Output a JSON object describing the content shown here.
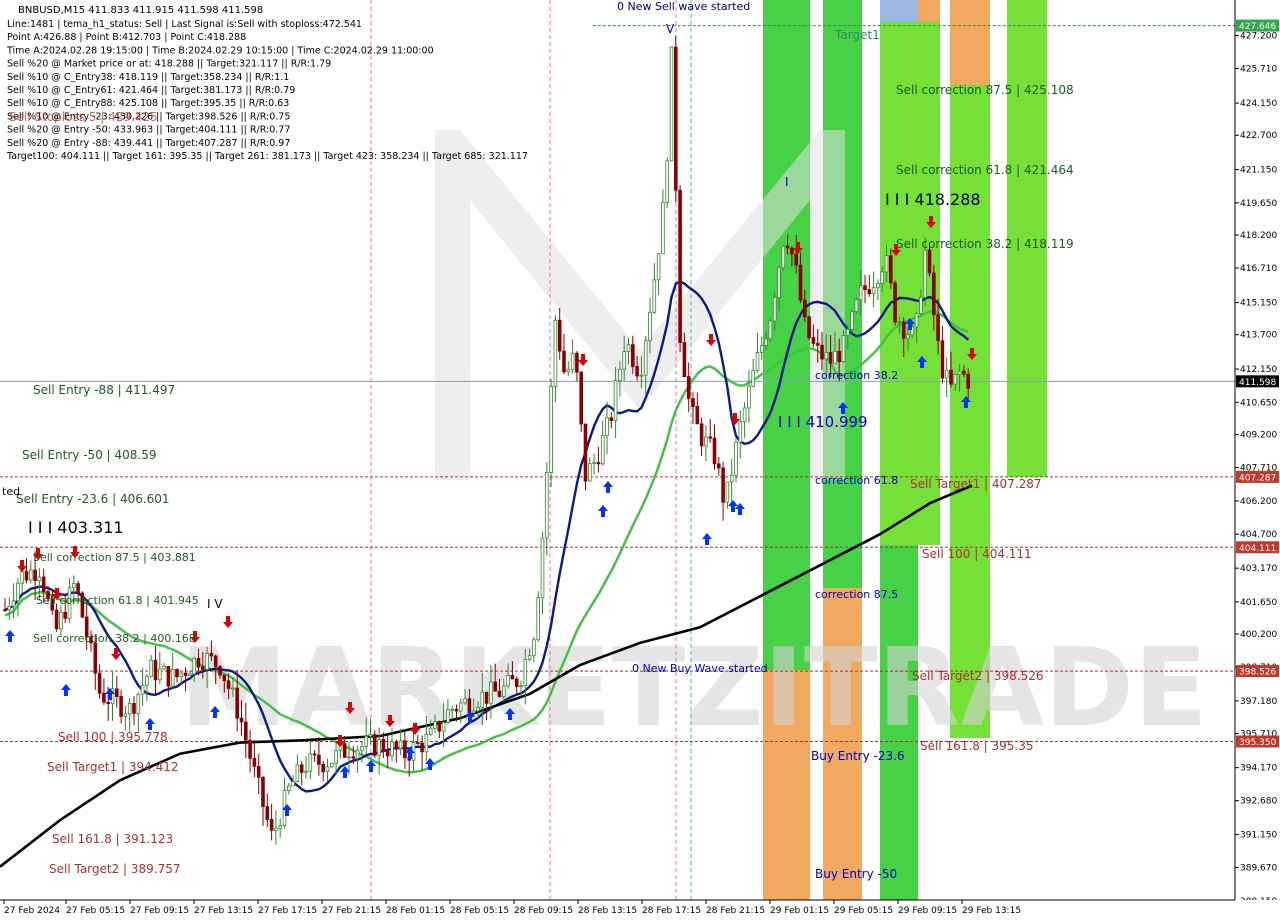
{
  "header": {
    "title": "BNBUSD,M15  411.833 411.915 411.598 411.598",
    "lines": [
      "Line:1481  | tema_h1_status: Sell  | Last Signal is:Sell with stoploss:472.541",
      "Point A:426.88  | Point B:412.703  | Point C:418.288",
      "Time A:2024.02.28 19:15:00  | Time B:2024.02.29 10:15:00  | Time C:2024.02.29 11:00:00",
      "Sell %20 @ Market price or at: 418.288  || Target:321.117  || R/R:1.79",
      "Sell %10 @ C_Entry38: 418.119  || Target:358.234  || R/R:1.1",
      "Sell %10 @ C_Entry61: 421.464  || Target:381.173  || R/R:0.79",
      "Sell %10 @ C_Entry88: 425.108  || Target:395.35  || R/R:0.63",
      "Sell %10 @ Entry -23: 430.226  || Target:398.526  || R/R:0.75",
      "Sell %20 @ Entry -50: 433.963  || Target:404.111  || R/R:0.77",
      "Sell %20 @ Entry -88: 439.441  || Target:407.287  || R/R:0.97",
      "Target100: 404.111  || Target 161: 395.35  || Target 261: 381.173  || Target 423: 358.234  || Target 685: 321.117"
    ],
    "overlay_red": "Sell Stoploss 5 | 429.425"
  },
  "watermark": "MARKETZITRADE",
  "chart_data": {
    "type": "candlestick",
    "symbol": "BNBUSD",
    "timeframe": "M15",
    "ylim": [
      388.2,
      428.8
    ],
    "y_ticks": [
      427.2,
      425.71,
      424.15,
      422.7,
      421.15,
      419.65,
      418.2,
      416.71,
      415.15,
      413.7,
      412.15,
      410.65,
      409.2,
      407.71,
      406.2,
      404.7,
      403.17,
      401.65,
      400.2,
      398.71,
      397.18,
      395.71,
      394.17,
      392.68,
      391.15,
      389.67,
      388.15
    ],
    "y_tick_labels": [
      "427.200",
      "425.710",
      "424.150",
      "422.700",
      "421.150",
      "419.650",
      "418.200",
      "416.710",
      "415.150",
      "413.700",
      "412.150",
      "410.650",
      "409.200",
      "407.710",
      "406.200",
      "404.700",
      "403.170",
      "401.650",
      "400.200",
      "398.710",
      "397.180",
      "395.710",
      "394.170",
      "392.680",
      "391.150",
      "389.670",
      "388.150"
    ],
    "x_labels": [
      "27 Feb 2024",
      "27 Feb 05:15",
      "27 Feb 09:15",
      "27 Feb 13:15",
      "27 Feb 17:15",
      "27 Feb 21:15",
      "28 Feb 01:15",
      "28 Feb 05:15",
      "28 Feb 09:15",
      "28 Feb 13:15",
      "28 Feb 17:15",
      "28 Feb 21:15",
      "29 Feb 01:15",
      "29 Feb 05:15",
      "29 Feb 09:15",
      "29 Feb 13:15"
    ],
    "current_price": 411.598,
    "price_badges": [
      {
        "value": 427.646,
        "label": "427.646",
        "color": "#2ea84a"
      },
      {
        "value": 411.598,
        "label": "411.598",
        "color": "#000000"
      },
      {
        "value": 407.287,
        "label": "407.287",
        "color": "#c0392b"
      },
      {
        "value": 404.111,
        "label": "404.111",
        "color": "#c0392b"
      },
      {
        "value": 398.526,
        "label": "398.526",
        "color": "#c0392b"
      },
      {
        "value": 395.35,
        "label": "395.350",
        "color": "#c0392b"
      }
    ],
    "h_levels": [
      {
        "value": 427.646,
        "color": "#2e8b57",
        "dashed": true,
        "x_from": 0.48
      },
      {
        "value": 411.598,
        "color": "#8a9bb0",
        "dashed": false,
        "x_from": 0.0
      },
      {
        "value": 407.287,
        "color": "#b03030",
        "dashed": true,
        "x_from": 0.0
      },
      {
        "value": 404.111,
        "color": "#b03030",
        "dashed": true,
        "x_from": 0.0
      },
      {
        "value": 398.526,
        "color": "#b03030",
        "dashed": true,
        "x_from": 0.0
      },
      {
        "value": 395.35,
        "color": "#b03030",
        "dashed": true,
        "x_from": 0.0
      }
    ],
    "annotations": [
      {
        "text": "0 New Sell wave started",
        "color": "#000080"
      },
      {
        "text": "Target1",
        "color": "#2e8b57"
      },
      {
        "text": "Sell correction 87.5 | 425.108",
        "color": "#1b5e20"
      },
      {
        "text": "Sell correction 61.8 | 421.464",
        "color": "#1b5e20"
      },
      {
        "text": "Sell correction 38.2 | 418.119",
        "color": "#1b5e20"
      },
      {
        "text": "I I I 418.288",
        "color": "#000000"
      },
      {
        "text": "correction 38.2",
        "color": "#0000cc"
      },
      {
        "text": "I I I 410.999",
        "color": "#0000cc"
      },
      {
        "text": "correction 61.8",
        "color": "#0000cc"
      },
      {
        "text": "Sell Target1 | 407.287",
        "color": "#b03030"
      },
      {
        "text": "Sell 100 | 404.111",
        "color": "#b03030"
      },
      {
        "text": "correction 87.5",
        "color": "#0000cc"
      },
      {
        "text": "0 New Buy Wave started",
        "color": "#0000cc"
      },
      {
        "text": "Sell Target2 | 398.526",
        "color": "#b03030"
      },
      {
        "text": "Buy Entry -23.6",
        "color": "#0000cc"
      },
      {
        "text": "Sell 161.8 | 395.35",
        "color": "#b03030"
      },
      {
        "text": "Buy Entry -50",
        "color": "#0000cc"
      },
      {
        "text": "Sell Entry -88 | 411.497",
        "color": "#1b5e20"
      },
      {
        "text": "Sell Entry -50 | 408.59",
        "color": "#1b5e20"
      },
      {
        "text": "Sell Entry -23.6 | 406.601",
        "color": "#1b5e20"
      },
      {
        "text": "I I I 403.311",
        "color": "#000000"
      },
      {
        "text": "Sell correction 87.5 | 403.881",
        "color": "#1b5e20"
      },
      {
        "text": "Sell correction 61.8 | 401.945",
        "color": "#1b5e20"
      },
      {
        "text": "Sell correction 38.2 | 400.168",
        "color": "#1b5e20"
      },
      {
        "text": "Sell 100 | 395.778",
        "color": "#b03030"
      },
      {
        "text": "Sell Target1 | 394.412",
        "color": "#b03030"
      },
      {
        "text": "Sell 161.8 | 391.123",
        "color": "#b03030"
      },
      {
        "text": "Sell Target2 | 389.757",
        "color": "#b03030"
      },
      {
        "text": "I V",
        "color": "#000000"
      },
      {
        "text": "ted",
        "color": "#000000"
      },
      {
        "text": "V",
        "color": "#0000cc"
      },
      {
        "text": "I",
        "color": "#0000cc"
      }
    ],
    "ma_legend": [
      "blue fast MA",
      "green MA",
      "black slow MA"
    ],
    "colors": {
      "bull_candle": "#2e8b2e",
      "bear_candle": "#8b0000",
      "ma_fast": "#0d1a8c",
      "ma_mid": "#3ec33e",
      "ma_slow": "#000000",
      "zone_green": "#33cc33",
      "zone_lime": "#66dd22",
      "zone_orange": "#f0a050",
      "sell_arrow": "#e00000",
      "buy_arrow": "#0033ff"
    }
  }
}
